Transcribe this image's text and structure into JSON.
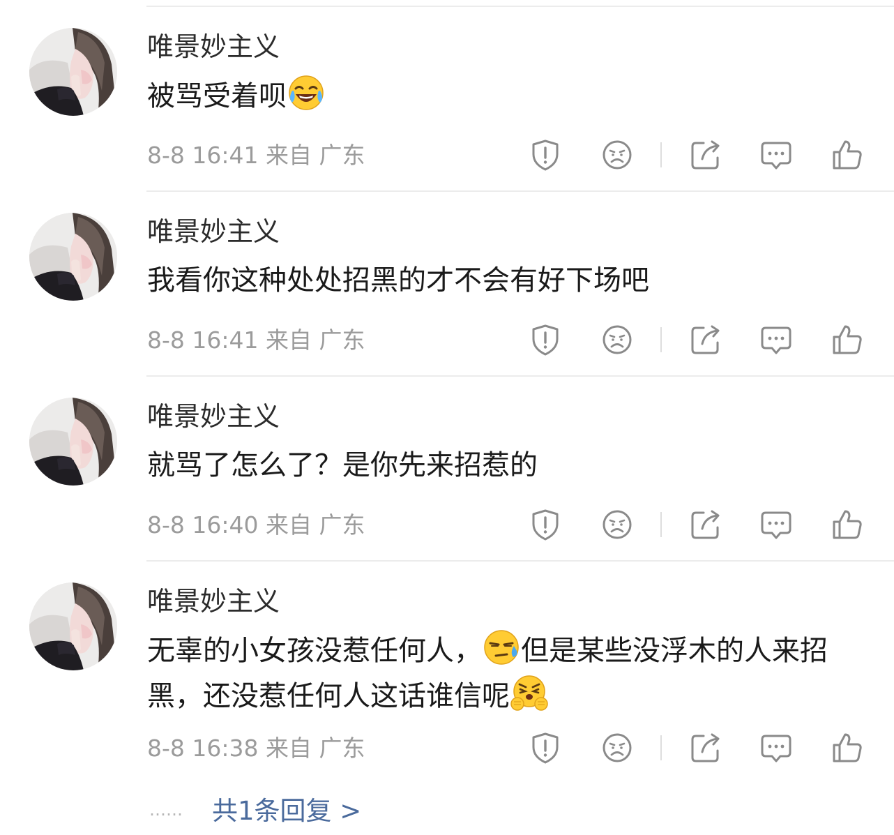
{
  "comments": [
    {
      "username": "唯景妙主义",
      "text": "被骂受着呗",
      "emoji_after": "tears-of-joy",
      "time": "8-8 16:41",
      "source": "来自 广东"
    },
    {
      "username": "唯景妙主义",
      "text": "我看你这种处处招黑的才不会有好下场吧",
      "time": "8-8 16:41",
      "source": "来自 广东"
    },
    {
      "username": "唯景妙主义",
      "text": "就骂了怎么了？是你先来招惹的",
      "time": "8-8 16:40",
      "source": "来自 广东"
    },
    {
      "username": "唯景妙主义",
      "text_part1": "无辜的小女孩没惹任何人，",
      "emoji_mid": "downcast-sweat",
      "text_part2": "但是某些没浮木的人来招黑，还没惹任何人这话谁信呢",
      "emoji_after": "huffing-fists",
      "time": "8-8 16:38",
      "source": "来自 广东"
    }
  ],
  "actions": [
    "report-icon",
    "dislike-icon",
    "share-icon",
    "comment-icon",
    "like-icon"
  ],
  "more_replies": {
    "dots": "……",
    "label": "共1条回复 >"
  },
  "colors": {
    "link": "#4a6a9c",
    "meta": "#9b9b9b",
    "icon": "#8a8a8a"
  }
}
